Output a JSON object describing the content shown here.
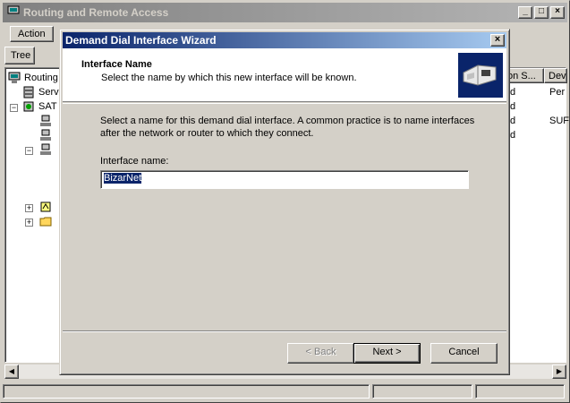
{
  "main_window": {
    "title": "Routing and Remote Access",
    "menu": {
      "action": "Action"
    },
    "tree_tab": "Tree",
    "tree_items": [
      "Routing",
      "Serv",
      "SAT"
    ],
    "list": {
      "columns": [
        "on S...",
        "Dev"
      ],
      "rows": [
        [
          "d",
          "Per"
        ],
        [
          "d",
          ""
        ],
        [
          "d",
          "SUF"
        ],
        [
          "d",
          ""
        ]
      ]
    }
  },
  "dialog": {
    "title": "Demand Dial Interface Wizard",
    "header_title": "Interface Name",
    "header_subtitle": "Select the name by which this new interface will be known.",
    "description": "Select a name for this demand dial interface.  A common practice is to name interfaces after the network or router to which they connect.",
    "field_label": "Interface name:",
    "field_value": "BizarNet",
    "buttons": {
      "back": "< Back",
      "next": "Next >",
      "cancel": "Cancel"
    }
  }
}
